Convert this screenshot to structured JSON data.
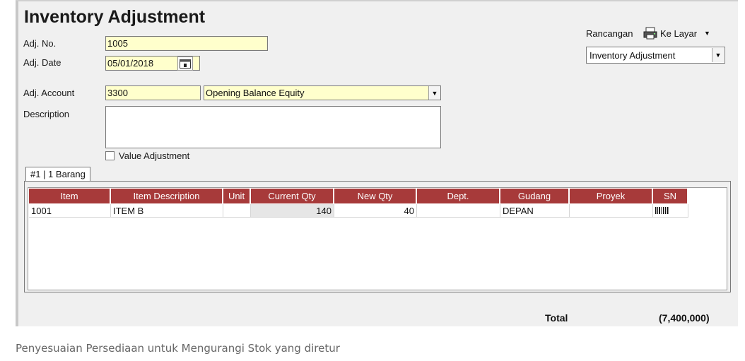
{
  "window": {
    "title": "Inventory Adjustment"
  },
  "form": {
    "adj_no_label": "Adj. No.",
    "adj_no_value": "1005",
    "adj_date_label": "Adj. Date",
    "adj_date_value": "05/01/2018",
    "adj_account_label": "Adj. Account",
    "adj_account_code": "3300",
    "adj_account_name": "Opening Balance Equity",
    "description_label": "Description",
    "description_value": "",
    "value_adjustment_label": "Value Adjustment",
    "value_adjustment_checked": false
  },
  "design": {
    "rancangan_label": "Rancangan",
    "output_button_label": "Ke Layar",
    "output_icon": "printer-icon",
    "template_selected": "Inventory Adjustment"
  },
  "tabs": [
    {
      "label": "#1 | 1 Barang"
    }
  ],
  "table": {
    "header_color": "#a73a3a",
    "columns": [
      "Item",
      "Item Description",
      "Unit",
      "Current Qty",
      "New Qty",
      "Dept.",
      "Gudang",
      "Proyek",
      "SN"
    ],
    "rows": [
      {
        "item": "1001",
        "description": "ITEM B",
        "unit": "",
        "current_qty": "140",
        "new_qty": "40",
        "dept": "",
        "gudang": "DEPAN",
        "proyek": "",
        "sn_icon": "barcode-icon"
      }
    ]
  },
  "footer": {
    "total_label": "Total",
    "total_value": "(7,400,000)"
  },
  "caption": "Penyesuaian Persediaan untuk Mengurangi Stok yang diretur"
}
